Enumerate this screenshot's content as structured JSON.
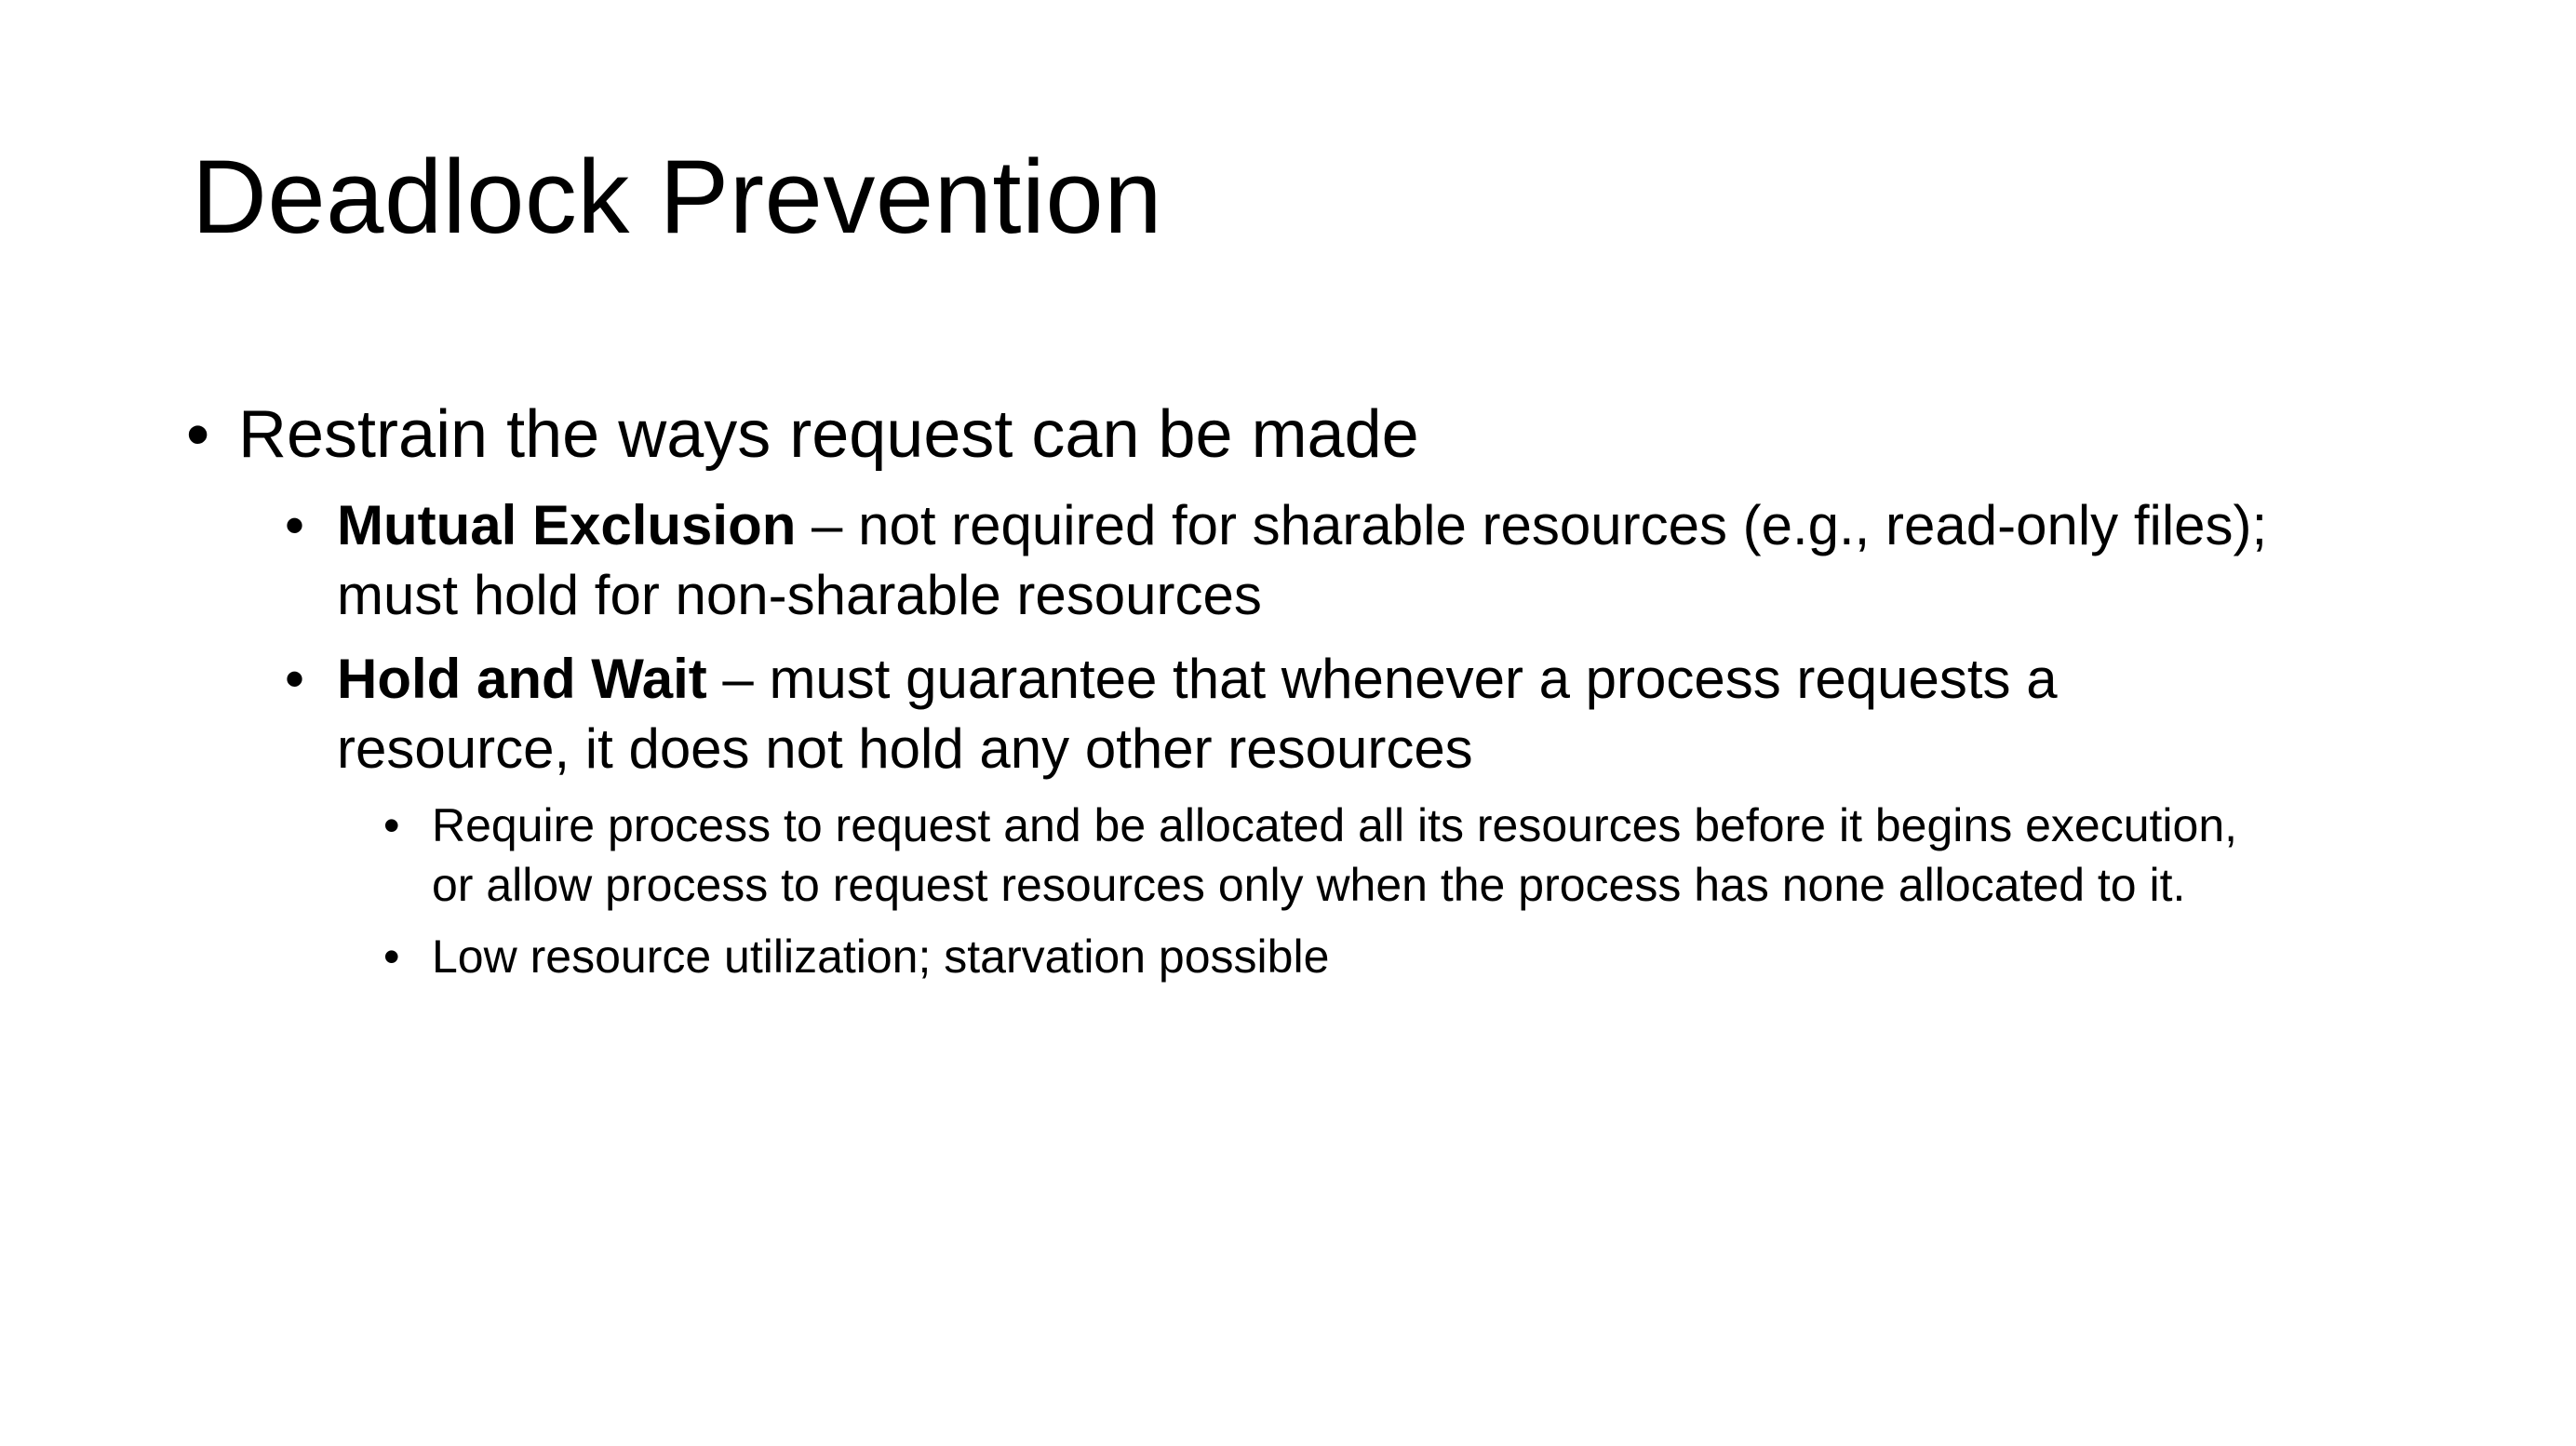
{
  "slide": {
    "title": "Deadlock Prevention",
    "bullet_char": "•",
    "items": [
      {
        "text": "Restrain the ways request can be made"
      }
    ],
    "sub_items": [
      {
        "term": "Mutual Exclusion",
        "line1": " – not required for sharable resources (e.g., read-only files);",
        "line2": "must hold for non-sharable resources"
      },
      {
        "term": "Hold and Wait",
        "line1": " – must guarantee that whenever a process requests a",
        "line2": "resource, it does not hold any other resources"
      }
    ],
    "sub_sub_items": [
      {
        "line1": "Require process to request and be allocated all its resources before it begins execution,",
        "line2": "or allow process to request resources only when the process has none allocated to it."
      },
      {
        "line1": "Low resource utilization; starvation possible"
      }
    ]
  }
}
